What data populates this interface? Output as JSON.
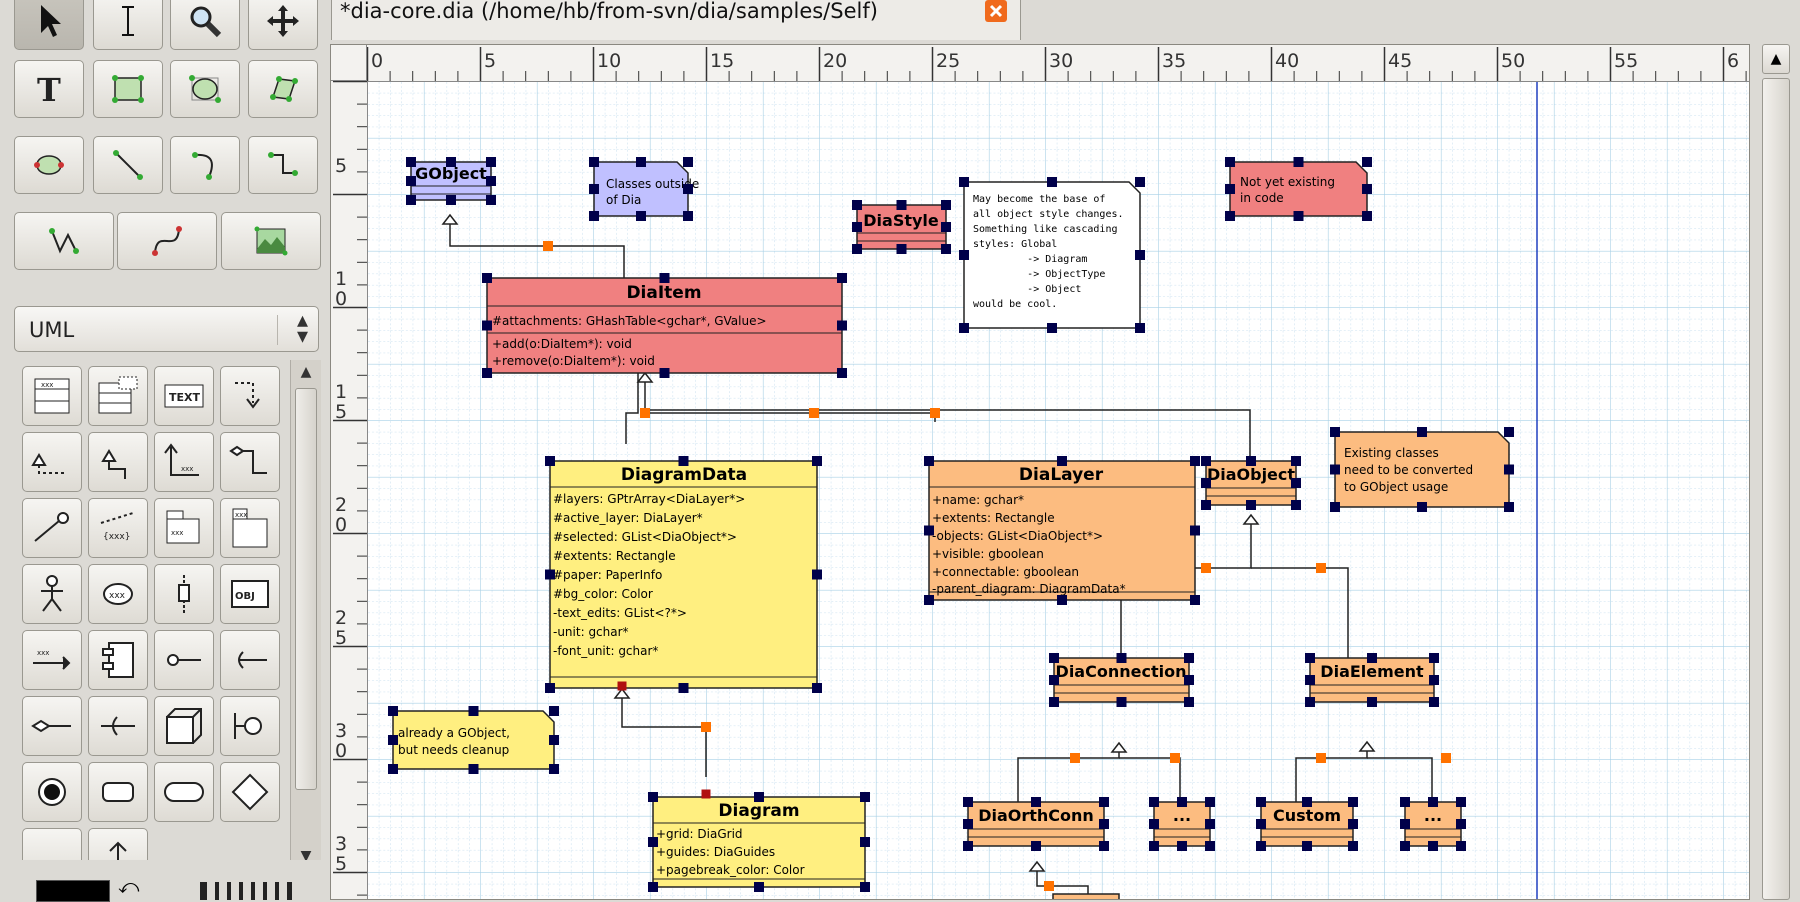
{
  "tab": {
    "title": "*dia-core.dia (/home/hb/from-svn/dia/samples/Self)"
  },
  "sheet": {
    "selected": "UML"
  },
  "hruler": {
    "labels": [
      "0",
      "5",
      "10",
      "15",
      "20",
      "25",
      "30",
      "35",
      "40",
      "45",
      "50",
      "55",
      "6"
    ]
  },
  "vruler": {
    "labels": [
      [
        "5"
      ],
      [
        "1",
        "0"
      ],
      [
        "1",
        "5"
      ],
      [
        "2",
        "0"
      ],
      [
        "2",
        "5"
      ],
      [
        "3",
        "0"
      ],
      [
        "3",
        "5"
      ]
    ]
  },
  "diagram": {
    "gobject": "GObject",
    "note_outside": [
      "Classes outside",
      "of Dia"
    ],
    "diastyle": "DiaStyle",
    "note_style": [
      "May become the base of",
      "all object style changes.",
      "Something like cascading",
      "styles: Global",
      "         -> Diagram",
      "         -> ObjectType",
      "         -> Object",
      "would be cool."
    ],
    "note_notyet": [
      "Not yet existing",
      "in code"
    ],
    "diaitem": {
      "name": "DiaItem",
      "attrs": [
        "#attachments: GHashTable<gchar*, GValue>"
      ],
      "ops": [
        "+add(o:DiaItem*): void",
        "+remove(o:DiaItem*): void"
      ]
    },
    "diagramdata": {
      "name": "DiagramData",
      "attrs": [
        "#layers: GPtrArray<DiaLayer*>",
        "#active_layer: DiaLayer*",
        "#selected: GList<DiaObject*>",
        "#extents: Rectangle",
        "#paper: PaperInfo",
        "#bg_color: Color",
        "-text_edits: GList<?*>",
        "-unit: gchar*",
        "-font_unit: gchar*"
      ]
    },
    "dialayer": {
      "name": "DiaLayer",
      "attrs": [
        "+name: gchar*",
        "+extents: Rectangle",
        "-objects: GList<DiaObject*>",
        "+visible: gboolean",
        "+connectable: gboolean",
        "-parent_diagram: DiagramData*"
      ]
    },
    "diaobject": "DiaObject",
    "note_existing": [
      "Existing classes",
      "need to be converted",
      "to GObject usage"
    ],
    "diaconnection": "DiaConnection",
    "diaelement": "DiaElement",
    "note_gobject": [
      "already a GObject,",
      "but needs cleanup"
    ],
    "diagram": {
      "name": "Diagram",
      "attrs": [
        "+grid: DiaGrid",
        "+guides: DiaGuides",
        "+pagebreak_color: Color"
      ]
    },
    "diaorthconn": "DiaOrthConn",
    "dots1": "...",
    "custom": "Custom",
    "dots2": "..."
  },
  "colors": {
    "red_class": "#f08080",
    "yellow_class": "#ffef80",
    "orange_class": "#fcbc80",
    "blue_class": "#c0c0ff",
    "grid_major": "#a8d0e6",
    "handle": "#00004a",
    "connection_point": "#ff7200"
  }
}
